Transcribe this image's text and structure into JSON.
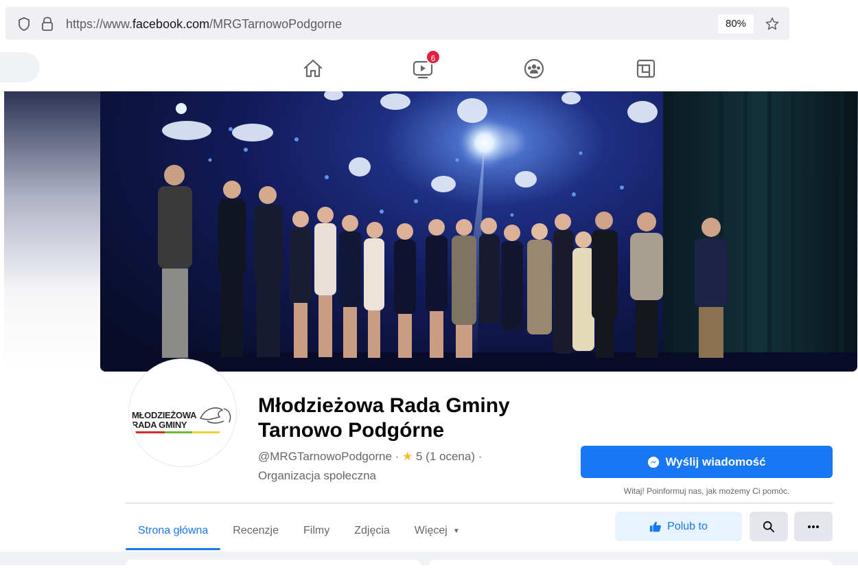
{
  "browser": {
    "url_prefix": "https://www.",
    "url_host": "facebook.com",
    "url_path": "/MRGTarnowoPodgorne",
    "zoom": "80%"
  },
  "fb_nav": {
    "watch_badge": "6",
    "icons": [
      "home-icon",
      "watch-icon",
      "groups-icon",
      "gaming-icon"
    ]
  },
  "profile": {
    "avatar_line1": "MŁODZIEŻOWA",
    "avatar_line2": "RADA GMINY",
    "title": "Młodzieżowa Rada Gminy Tarnowo Podgórne",
    "handle": "@MRGTarnowoPodgorne · ",
    "rating": " 5 (1 ocena) ·",
    "category": "Organizacja społeczna",
    "message_button": "Wyślij wiadomość",
    "message_hint": "Witaj! Poinformuj nas, jak możemy Ci pomóc."
  },
  "tabs": [
    {
      "label": "Strona główna",
      "active": true
    },
    {
      "label": "Recenzje",
      "active": false
    },
    {
      "label": "Filmy",
      "active": false
    },
    {
      "label": "Zdjęcia",
      "active": false
    },
    {
      "label": "Więcej",
      "active": false
    }
  ],
  "actions": {
    "like_label": "Polub to"
  },
  "colors": {
    "brand": "#1877f2",
    "rating_star": "#f7b928",
    "badge": "#e41e3f"
  }
}
